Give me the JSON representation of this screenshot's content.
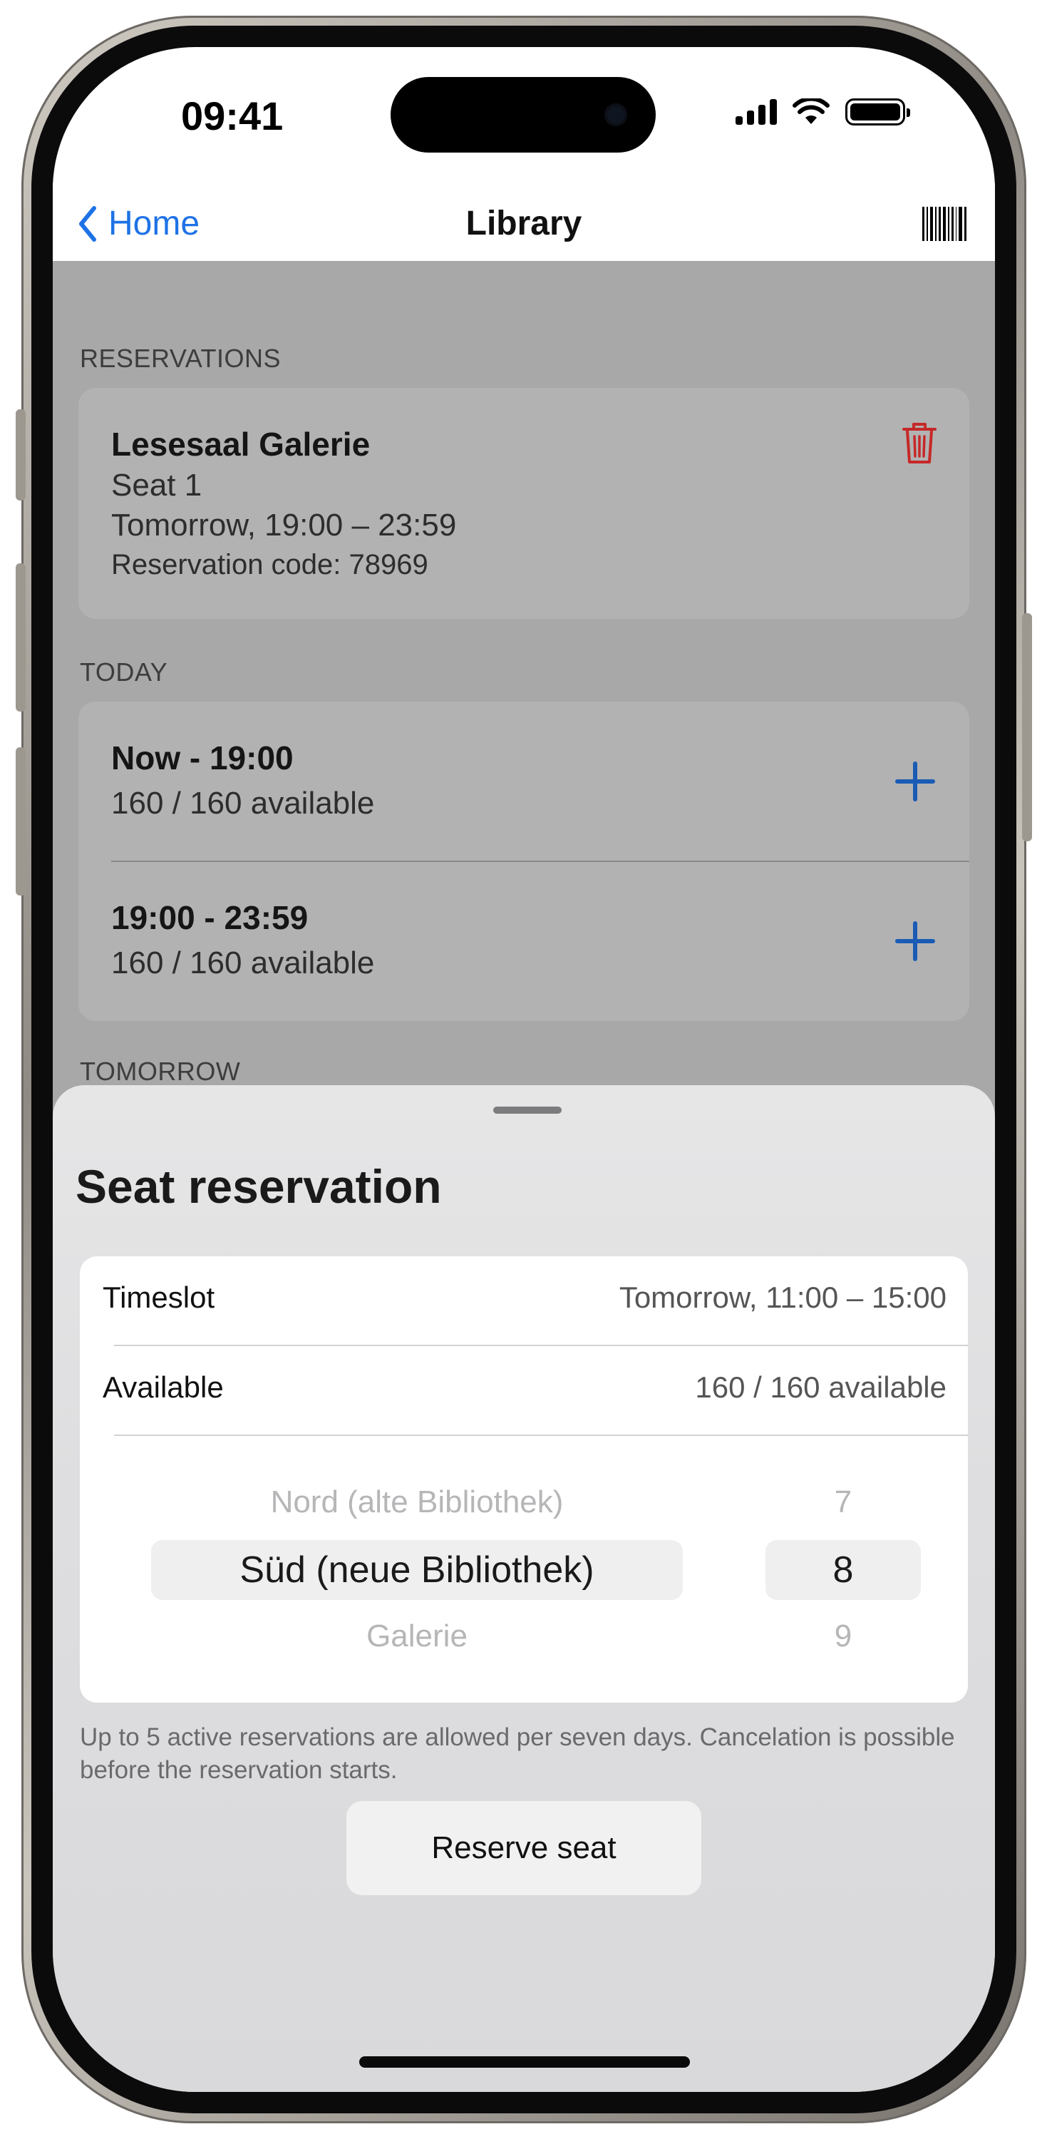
{
  "status_bar": {
    "time": "09:41"
  },
  "navbar": {
    "back_label": "Home",
    "title": "Library"
  },
  "reservations": {
    "header": "RESERVATIONS",
    "item": {
      "location": "Lesesaal Galerie",
      "seat": "Seat 1",
      "time": "Tomorrow, 19:00 – 23:59",
      "code": "Reservation code: 78969"
    }
  },
  "today": {
    "header": "TODAY",
    "slots": [
      {
        "time": "Now - 19:00",
        "available": "160 / 160 available"
      },
      {
        "time": "19:00 - 23:59",
        "available": "160 / 160 available"
      }
    ]
  },
  "tomorrow": {
    "header": "TOMORROW"
  },
  "sheet": {
    "title": "Seat reservation",
    "timeslot_label": "Timeslot",
    "timeslot_value": "Tomorrow, 11:00 – 15:00",
    "available_label": "Available",
    "available_value": "160 / 160 available",
    "area_picker": {
      "above": "Nord (alte Bibliothek)",
      "selected": "Süd (neue Bibliothek)",
      "below": "Galerie"
    },
    "seat_picker": {
      "above": "7",
      "selected": "8",
      "below": "9"
    },
    "footer": "Up to 5 active reservations are allowed per seven days. Cancelation is possible before the reservation starts.",
    "reserve_button": "Reserve seat"
  },
  "colors": {
    "accent": "#1e72e6",
    "delete": "#c62828",
    "dim_overlay": "#a8a8a8"
  }
}
